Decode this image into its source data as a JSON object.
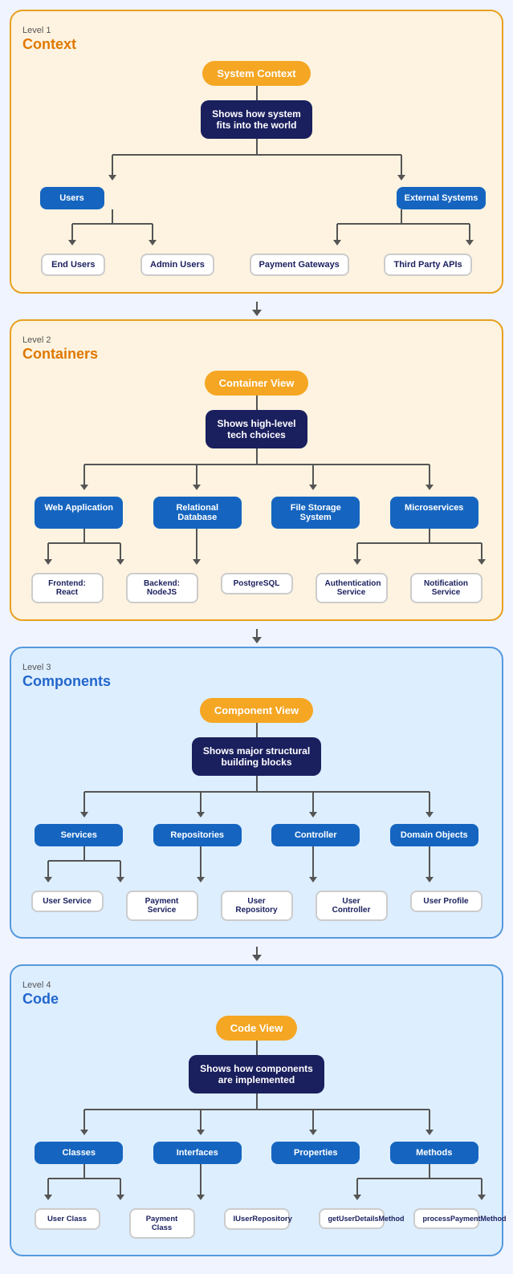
{
  "levels": [
    {
      "id": "level1",
      "label": "Level 1",
      "title": "Context",
      "topNode": "System Context",
      "centerNode": "Shows how system\nfits into the world",
      "midNodes": [
        {
          "label": "Users",
          "side": "left"
        },
        {
          "label": "External Systems",
          "side": "right"
        }
      ],
      "bottomNodes": [
        {
          "label": "End Users"
        },
        {
          "label": "Admin Users"
        },
        {
          "label": "Payment Gateways"
        },
        {
          "label": "Third Party APIs"
        }
      ]
    },
    {
      "id": "level2",
      "label": "Level 2",
      "title": "Containers",
      "topNode": "Container View",
      "centerNode": "Shows high-level\ntech choices",
      "midNodes": [
        {
          "label": "Web Application"
        },
        {
          "label": "Relational\nDatabase"
        },
        {
          "label": "File Storage\nSystem"
        },
        {
          "label": "Microservices"
        }
      ],
      "bottomNodes": [
        {
          "label": "Frontend: React"
        },
        {
          "label": "Backend: NodeJS"
        },
        {
          "label": "PostgreSQL"
        },
        {
          "label": "Authentication\nService"
        },
        {
          "label": "Notification\nService"
        }
      ]
    },
    {
      "id": "level3",
      "label": "Level 3",
      "title": "Components",
      "topNode": "Component View",
      "centerNode": "Shows major structural\nbuilding blocks",
      "midNodes": [
        {
          "label": "Services"
        },
        {
          "label": "Repositories"
        },
        {
          "label": "Controller"
        },
        {
          "label": "Domain Objects"
        }
      ],
      "bottomNodes": [
        {
          "label": "User Service"
        },
        {
          "label": "Payment Service"
        },
        {
          "label": "User Repository"
        },
        {
          "label": "User Controller"
        },
        {
          "label": "User Profile"
        }
      ]
    },
    {
      "id": "level4",
      "label": "Level 4",
      "title": "Code",
      "topNode": "Code View",
      "centerNode": "Shows how components\nare implemented",
      "midNodes": [
        {
          "label": "Classes"
        },
        {
          "label": "Interfaces"
        },
        {
          "label": "Properties"
        },
        {
          "label": "Methods"
        }
      ],
      "bottomNodes": [
        {
          "label": "User Class"
        },
        {
          "label": "Payment Class"
        },
        {
          "label": "IUserRepository"
        },
        {
          "label": "getUserDetailsMethod"
        },
        {
          "label": "processPaymentMethod"
        }
      ]
    }
  ]
}
